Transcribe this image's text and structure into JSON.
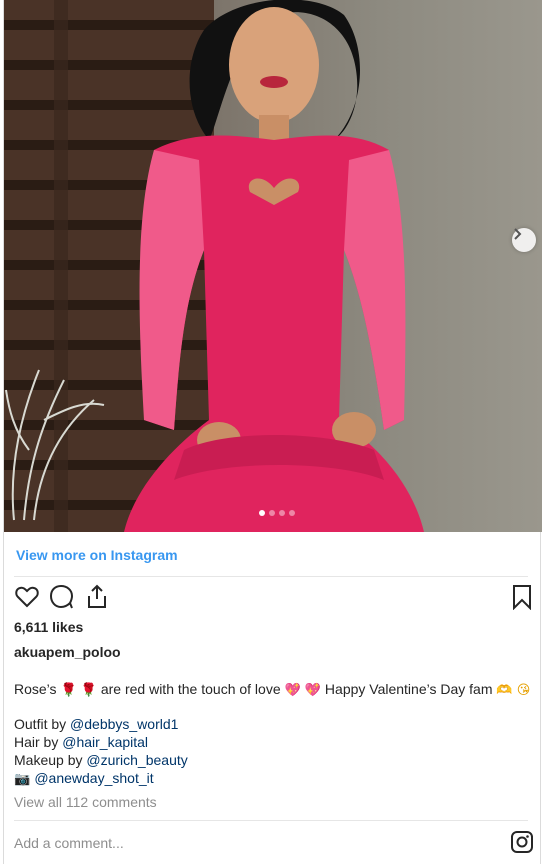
{
  "post": {
    "view_more_label": "View more on Instagram",
    "likes": "6,611 likes",
    "username": "akuapem_poloo",
    "caption": {
      "part1": "Rose’s ",
      "emoji_roses": "🌹 🌹",
      "part2": " are red with the touch of love ",
      "emoji_hearts": "💖 💖",
      "part3": " Happy Valentine’s Day fam ",
      "emoji_end": "🫶 😘"
    },
    "credits": [
      {
        "label": "Outfit by ",
        "mention": "@debbys_world1"
      },
      {
        "label": "Hair by ",
        "mention": "@hair_kapital"
      },
      {
        "label": "Makeup by ",
        "mention": "@zurich_beauty"
      },
      {
        "label": "📷  ",
        "mention": "@anewday_shot_it"
      }
    ],
    "comments_link": "View all 112 comments",
    "add_comment_placeholder": "Add a comment..."
  },
  "carousel": {
    "count": 4,
    "active_index": 0
  },
  "icons": {
    "like": "heart-icon",
    "comment": "comment-icon",
    "share": "share-icon",
    "save": "bookmark-icon",
    "next": "chevron-right-icon",
    "logo": "instagram-logo-icon"
  },
  "colors": {
    "link": "#3897f0",
    "mention": "#003569",
    "muted": "#8e8e8e",
    "dress": "#e0245e"
  }
}
